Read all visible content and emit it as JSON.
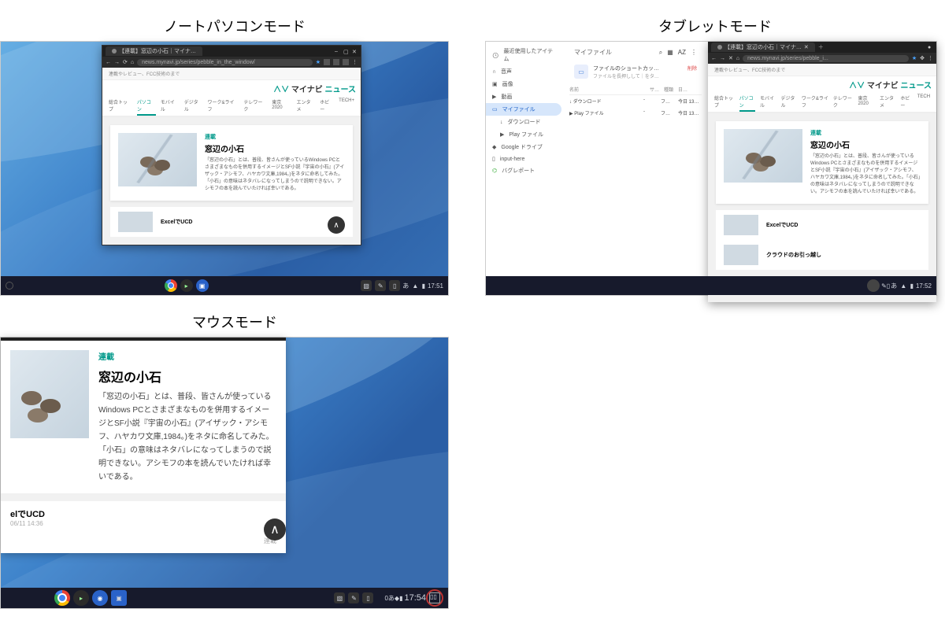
{
  "modes": {
    "laptop": "ノートパソコンモード",
    "tablet": "タブレットモード",
    "mouse": "マウスモード"
  },
  "browser": {
    "tab_title": "【連載】窓辺の小石｜マイナ…",
    "url": "news.mynavi.jp/series/pebble_in_the_window/",
    "url_short": "news.mynavi.jp/series/pebble_i...",
    "subbar": "連載やレビュー、FCC技術のまで",
    "brand_logo": "マイナビ",
    "brand_suffix": "ニュース",
    "nav": [
      "総合トップ",
      "パソコン",
      "モバイル",
      "デジタル",
      "ワーク&ライフ",
      "テレワーク",
      "東京2020",
      "エンタメ",
      "ホビー",
      "TECH+"
    ],
    "nav_short": [
      "総合トップ",
      "パソコン",
      "モバイル",
      "デジタル",
      "ワーク&ライフ",
      "テレワーク",
      "東京2020",
      "エンタメ",
      "ホビー",
      "TECH"
    ],
    "active_nav_index": 1,
    "article": {
      "category": "連載",
      "title": "窓辺の小石",
      "body": "「窓辺の小石」とは、普段、皆さんが使っているWindows PCとさまざまなものを併用するイメージとSF小説『宇宙の小石』(アイザック・アシモフ、ハヤカワ文庫,1984。)をネタに命名してみた。「小石」の意味はネタバレになってしまうので説明できない。アシモフの本を読んでいたければ幸いである。"
    },
    "card2_title": "ExcelでUCD",
    "card3_title": "クラウドのお引っ越し"
  },
  "files": {
    "app_title": "最近使用したアイテム",
    "header": "マイファイル",
    "delete_label": "削除",
    "shortcut_line1": "ファイルのショートカッ…",
    "shortcut_line2": "ファイルを長押しして｜をタ…",
    "sidebar": {
      "recent": "最近使用したアイテム",
      "audio": "音声",
      "images": "画像",
      "videos": "動画",
      "myfiles": "マイファイル",
      "downloads": "ダウンロード",
      "play": "Play ファイル",
      "drive": "Google ドライブ",
      "input": "input-here",
      "bug": "バグレポート"
    },
    "cols": {
      "name": "名前",
      "size": "サ…",
      "type": "種類",
      "date": "日…"
    },
    "rows": [
      {
        "icon": "download",
        "name": "ダウンロード",
        "size": "-",
        "type": "フ…",
        "date": "今日 13…"
      },
      {
        "icon": "play",
        "name": "Play ファイル",
        "size": "-",
        "type": "フ…",
        "date": "今日 13…"
      }
    ]
  },
  "mouse_pane": {
    "second_title": "elでUCD",
    "second_date": "06/11 14:36",
    "continue": "連載"
  },
  "taskbar": {
    "time_laptop": "17:51",
    "time_tablet": "17:52",
    "time_mouse": "17:54",
    "ime": "あ",
    "battery": "0"
  }
}
